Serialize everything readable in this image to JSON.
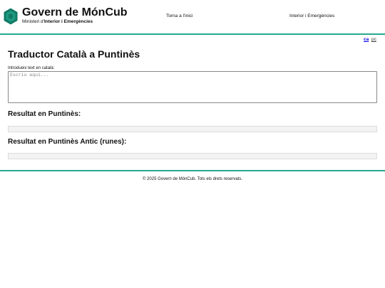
{
  "header": {
    "title": "Govern de MónCub",
    "subtitle_prefix": "Ministeri d'",
    "subtitle_bold": "Interior i Emergències",
    "logo_icon": "hexagon-logo-icon",
    "logo_color": "#0f7a66",
    "nav": {
      "home_label": "Torna a l'inici",
      "ministry_label": "Interior i Emergències"
    }
  },
  "accent_color": "#25a88f",
  "language": {
    "options": [
      "ca",
      "pc"
    ],
    "selected": "ca"
  },
  "main": {
    "title": "Traductor Català a Puntinès",
    "input_label": "Introdueix text en català:",
    "input_placeholder": "Escriu aquí...",
    "input_value": "",
    "result_title": "Resultat en Puntinès:",
    "result_value": "",
    "runes_title": "Resultat en Puntinès Antic (runes):",
    "runes_value": ""
  },
  "footer": {
    "text": "© 2025 Govern de MónCub. Tots els drets reservats."
  }
}
